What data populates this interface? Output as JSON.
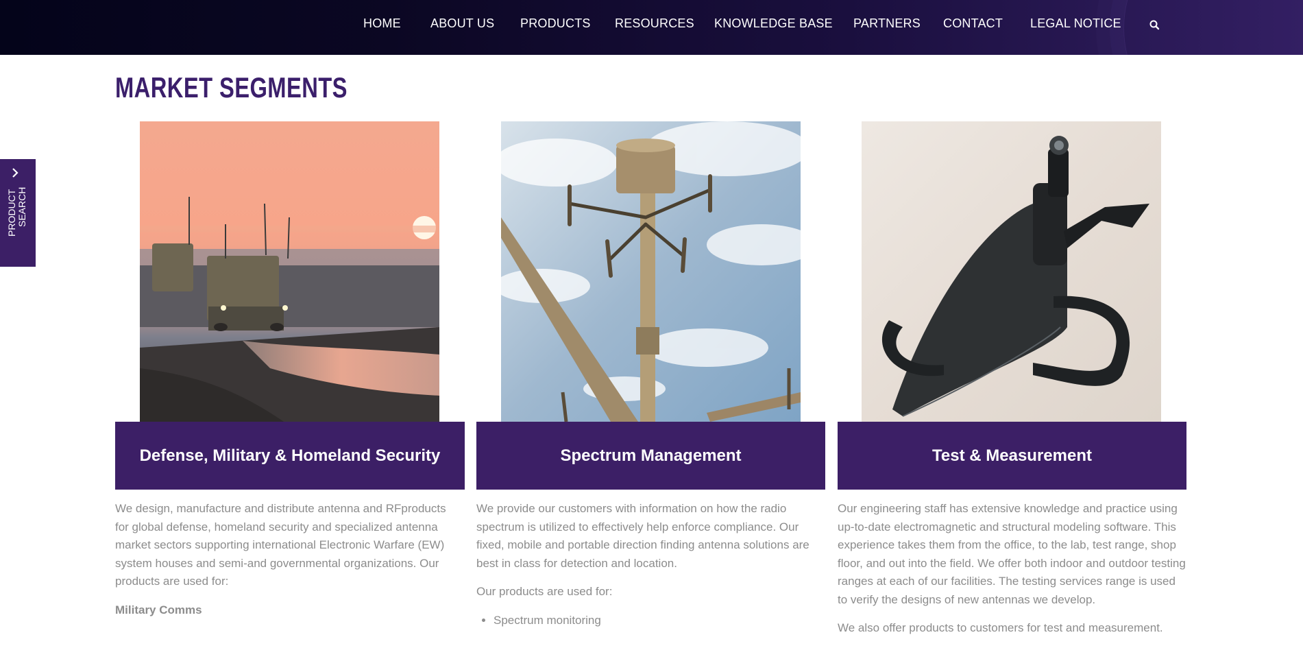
{
  "nav": {
    "items": [
      {
        "label": "HOME"
      },
      {
        "label": "ABOUT US"
      },
      {
        "label": "PRODUCTS"
      },
      {
        "label": "RESOURCES"
      },
      {
        "label": "KNOWLEDGE BASE"
      },
      {
        "label": "PARTNERS"
      },
      {
        "label": "CONTACT"
      },
      {
        "label": "LEGAL NOTICE"
      }
    ],
    "search_icon": "search-icon"
  },
  "page": {
    "title": "MARKET SEGMENTS"
  },
  "side_tab": {
    "line1": "PRODUCT",
    "line2": "SEARCH",
    "icon": "chevron-right-icon"
  },
  "segments": [
    {
      "title": "Defense, Military & Homeland Security",
      "paragraph": "We design, manufacture and distribute antenna and RFproducts for global defense, homeland security and specialized antenna market sectors supporting international Electronic Warfare (EW) system houses and semi-and governmental organizations. Our products are used for:",
      "subheading": "Military Comms"
    },
    {
      "title": "Spectrum Management",
      "paragraph": "We provide our customers with information on how the radio spectrum is utilized to effectively help enforce compliance. Our fixed, mobile and portable direction finding antenna solutions are best in class for detection and location.",
      "paragraph2": "Our products are used for:",
      "list": [
        "Spectrum monitoring"
      ]
    },
    {
      "title": "Test & Measurement",
      "paragraph": "Our engineering staff has extensive knowledge and practice using up-to-date electromagnetic and structural modeling software. This experience takes them from the office, to the lab, test range, shop floor, and out into the field. We offer both indoor and outdoor testing ranges at each of our facilities. The testing services range is used to verify the designs of new antennas we develop.",
      "paragraph2": "We also offer products to customers for test and measurement."
    }
  ],
  "colors": {
    "brand_purple": "#3c1f66",
    "title_purple": "#3b1f6b",
    "body_text": "#8c8c8c"
  }
}
